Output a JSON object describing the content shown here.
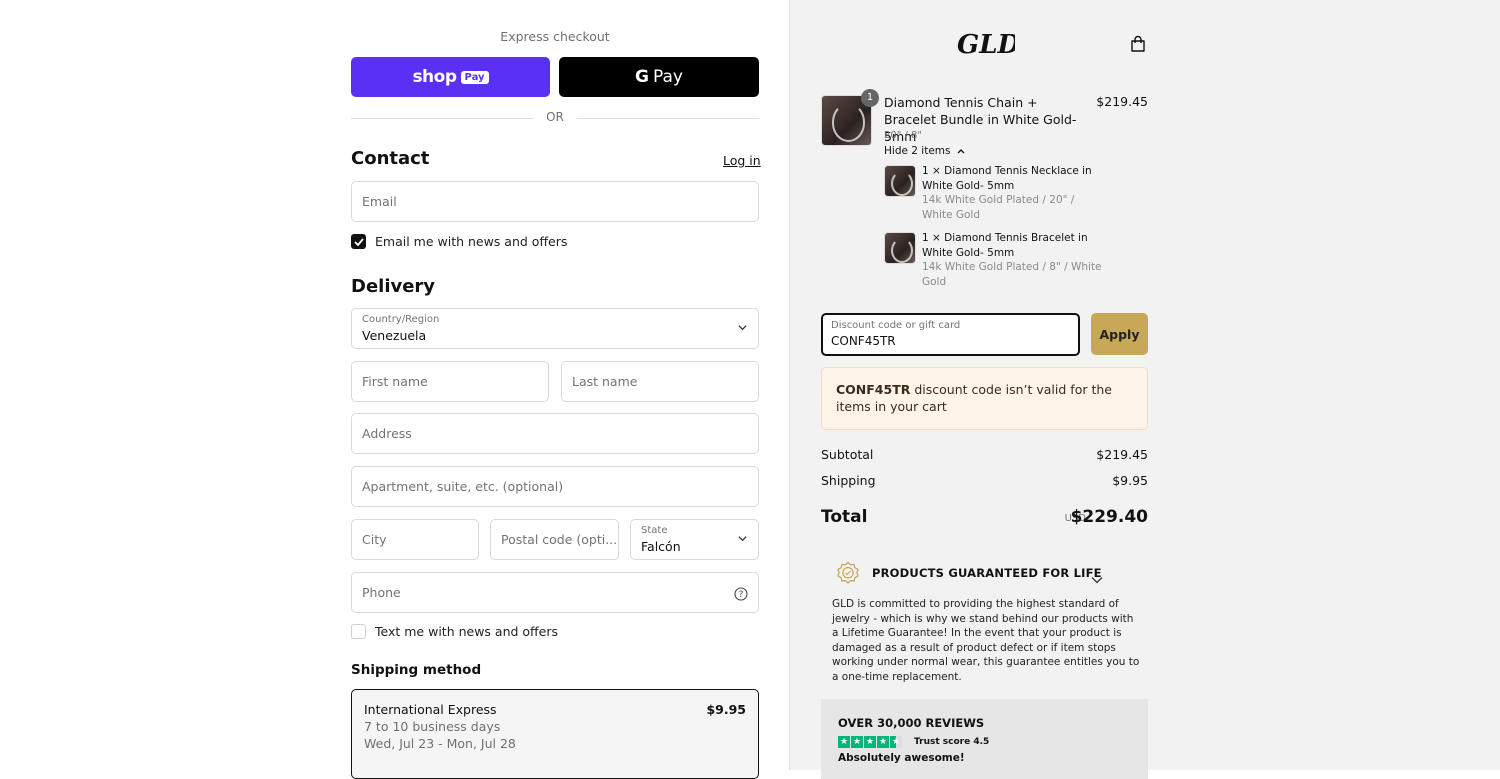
{
  "express": {
    "title": "Express checkout",
    "shop_pay_word": "shop",
    "shop_pay_chip": "Pay",
    "gpay_g": "G",
    "gpay_word": "Pay",
    "or_label": "OR"
  },
  "contact": {
    "heading": "Contact",
    "login_link": "Log in",
    "email_placeholder": "Email",
    "newsletter_label": "Email me with news and offers",
    "newsletter_checked": true
  },
  "delivery": {
    "heading": "Delivery",
    "country_label": "Country/Region",
    "country_value": "Venezuela",
    "first_name_placeholder": "First name",
    "last_name_placeholder": "Last name",
    "address_placeholder": "Address",
    "apartment_placeholder": "Apartment, suite, etc. (optional)",
    "city_placeholder": "City",
    "postal_placeholder": "Postal code (opti...",
    "state_label": "State",
    "state_value": "Falcón",
    "phone_placeholder": "Phone",
    "sms_label": "Text me with news and offers",
    "sms_checked": false
  },
  "shipping": {
    "heading": "Shipping method",
    "method_name": "International Express",
    "method_days": "7 to 10 business days",
    "method_dates": "Wed, Jul 23 - Mon, Jul 28",
    "method_price": "$9.95"
  },
  "order": {
    "logo_text": "GLD",
    "item": {
      "quantity": "1",
      "name": "Diamond Tennis Chain + Bracelet Bundle in White Gold- 5mm",
      "variant": "20\" / 8\"",
      "price": "$219.45",
      "toggle_label": "Hide 2 items"
    },
    "sub_items": [
      {
        "name": "1 × Diamond Tennis Necklace in White Gold- 5mm",
        "variant": "14k White Gold Plated / 20\" / White Gold"
      },
      {
        "name": "1 × Diamond Tennis Bracelet in White Gold- 5mm",
        "variant": "14k White Gold Plated / 8\" / White Gold"
      }
    ],
    "discount": {
      "label": "Discount code or gift card",
      "value": "CONF45TR",
      "apply_label": "Apply",
      "error_code": "CONF45TR",
      "error_text": "discount code isn’t valid for the items in your cart"
    },
    "subtotal_label": "Subtotal",
    "subtotal_value": "$219.45",
    "shipping_label": "Shipping",
    "shipping_value": "$9.95",
    "total_label": "Total",
    "total_currency": "USD",
    "total_value": "$229.40"
  },
  "guarantee": {
    "title": "PRODUCTS GUARANTEED FOR LIFE",
    "text": "GLD is committed to providing the highest standard of jewelry - which is why we stand behind our products with a Lifetime Guarantee! In the event that your product is damaged as a result of product defect or if item stops working under normal wear, this guarantee entitles you to a one-time replacement."
  },
  "reviews": {
    "title": "OVER 30,000 REVIEWS",
    "trust_score": "Trust score 4.5",
    "rating": 4.5,
    "tagline": "Absolutely awesome!"
  },
  "colors": {
    "shop_pay": "#5a31f4",
    "apply_gold": "#c6a856",
    "trustpilot_green": "#00b67a"
  }
}
